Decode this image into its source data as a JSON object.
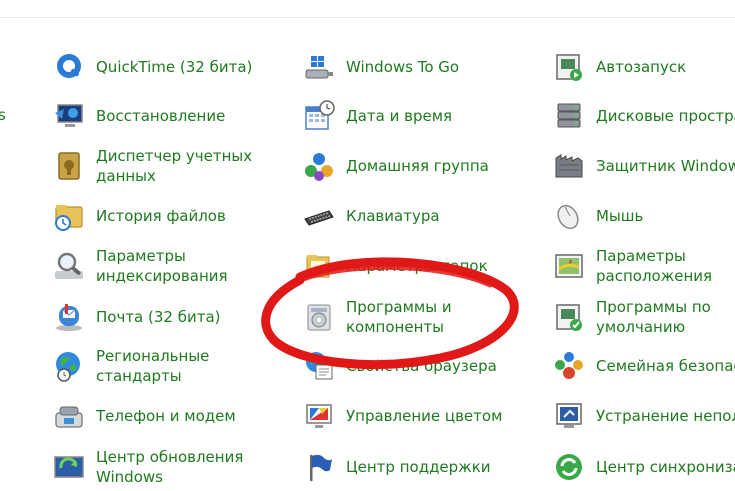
{
  "cut_label": "s",
  "col1": [
    {
      "label": "QuickTime (32 бита)",
      "icon": "quicktime-icon"
    },
    {
      "label": "Восстановление",
      "icon": "recovery-icon"
    },
    {
      "label": "Диспетчер учетных\nданных",
      "icon": "credential-manager-icon"
    },
    {
      "label": "История файлов",
      "icon": "file-history-icon"
    },
    {
      "label": "Параметры\nиндексирования",
      "icon": "indexing-icon"
    },
    {
      "label": "Почта (32 бита)",
      "icon": "mail-icon"
    },
    {
      "label": "Региональные стандарты",
      "icon": "region-icon"
    },
    {
      "label": "Телефон и модем",
      "icon": "phone-modem-icon"
    },
    {
      "label": "Центр обновления\nWindows",
      "icon": "windows-update-icon"
    }
  ],
  "col2": [
    {
      "label": "Windows To Go",
      "icon": "windows-to-go-icon"
    },
    {
      "label": "Дата и время",
      "icon": "date-time-icon"
    },
    {
      "label": "Домашняя группа",
      "icon": "homegroup-icon"
    },
    {
      "label": "Клавиатура",
      "icon": "keyboard-icon"
    },
    {
      "label": "Параметры папок",
      "icon": "folder-options-icon"
    },
    {
      "label": "Программы и\nкомпоненты",
      "icon": "programs-features-icon"
    },
    {
      "label": "Свойства браузера",
      "icon": "browser-properties-icon"
    },
    {
      "label": "Управление цветом",
      "icon": "color-management-icon"
    },
    {
      "label": "Центр поддержки",
      "icon": "action-center-icon"
    }
  ],
  "col3": [
    {
      "label": "Автозапуск",
      "icon": "autoplay-icon"
    },
    {
      "label": "Дисковые простран",
      "icon": "storage-spaces-icon"
    },
    {
      "label": "Защитник Windows",
      "icon": "windows-defender-icon"
    },
    {
      "label": "Мышь",
      "icon": "mouse-icon"
    },
    {
      "label": "Параметры\nрасположения",
      "icon": "location-settings-icon"
    },
    {
      "label": "Программы по\nумолчанию",
      "icon": "default-programs-icon"
    },
    {
      "label": "Семейная безопасн",
      "icon": "family-safety-icon"
    },
    {
      "label": "Устранение непола",
      "icon": "troubleshooting-icon"
    },
    {
      "label": "Центр синхронизац",
      "icon": "sync-center-icon"
    }
  ],
  "colors": {
    "link": "#1e7a1e",
    "highlight_ellipse": "#e01818"
  }
}
